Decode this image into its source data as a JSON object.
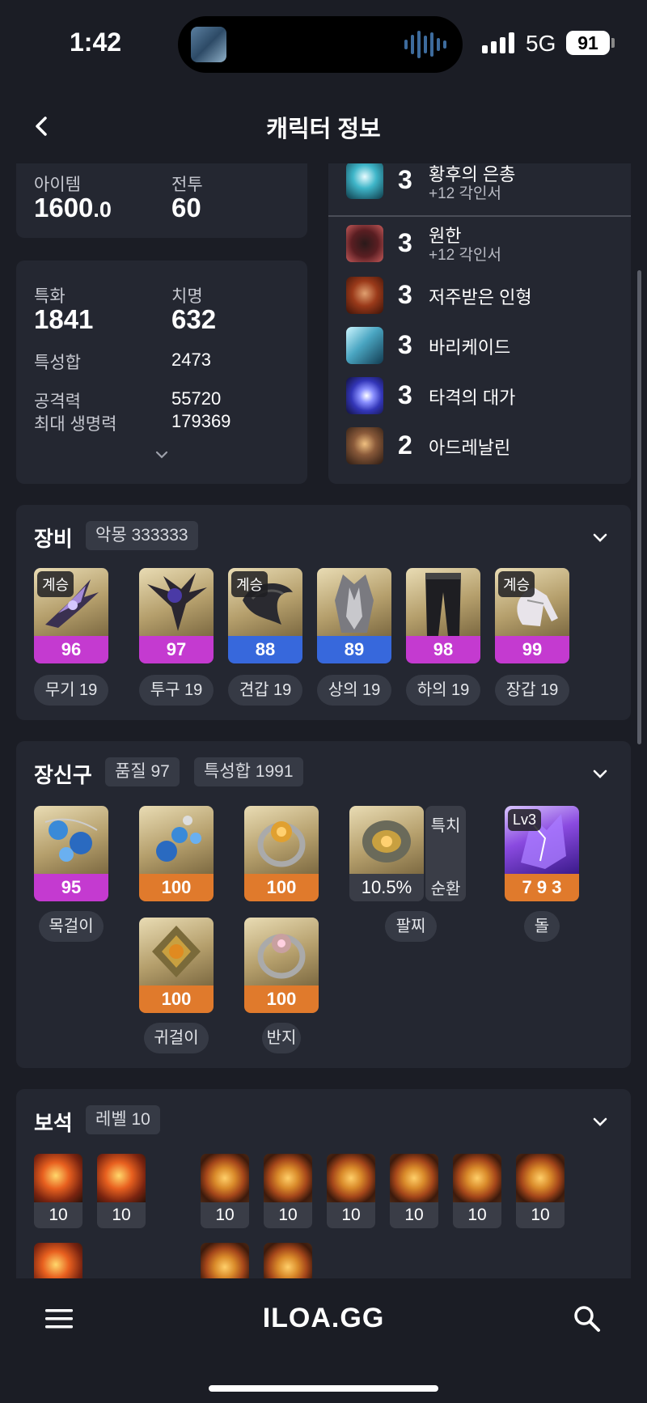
{
  "status": {
    "time": "1:42",
    "network": "5G",
    "battery": "91"
  },
  "header": {
    "title": "캐릭터 정보"
  },
  "stats_top": {
    "item_label": "아이템",
    "item_value": "1600",
    "item_decimal": ".0",
    "combat_label": "전투",
    "combat_value": "60"
  },
  "stats": {
    "spec_label": "특화",
    "spec_value": "1841",
    "crit_label": "치명",
    "crit_value": "632",
    "trait_sum_label": "특성합",
    "trait_sum_value": "2473",
    "attack_label": "공격력",
    "attack_value": "55720",
    "hp_label": "최대 생명력",
    "hp_value": "179369"
  },
  "engravings": [
    {
      "level": "3",
      "name": "황후의 은총",
      "sub": "+12 각인서",
      "icon_color": "#3fb6c9"
    },
    {
      "level": "3",
      "name": "원한",
      "sub": "+12 각인서",
      "icon_color": "#8a2a2a"
    },
    {
      "level": "3",
      "name": "저주받은 인형",
      "sub": "",
      "icon_color": "#b5522a"
    },
    {
      "level": "3",
      "name": "바리케이드",
      "sub": "",
      "icon_color": "#4aa6c2"
    },
    {
      "level": "3",
      "name": "타격의 대가",
      "sub": "",
      "icon_color": "#5b63e0"
    },
    {
      "level": "2",
      "name": "아드레날린",
      "sub": "",
      "icon_color": "#8a5a3a"
    }
  ],
  "equipment": {
    "title": "장비",
    "set_chip": "악몽 333333",
    "items": [
      {
        "quality": "96",
        "slot": "무기 19",
        "inherit": "계승",
        "color": "purple"
      },
      {
        "quality": "97",
        "slot": "투구 19",
        "inherit": "",
        "color": "purple"
      },
      {
        "quality": "88",
        "slot": "견갑 19",
        "inherit": "계승",
        "color": "blue"
      },
      {
        "quality": "89",
        "slot": "상의 19",
        "inherit": "",
        "color": "blue"
      },
      {
        "quality": "98",
        "slot": "하의 19",
        "inherit": "",
        "color": "purple"
      },
      {
        "quality": "99",
        "slot": "장갑 19",
        "inherit": "계승",
        "color": "purple"
      }
    ]
  },
  "accessories": {
    "title": "장신구",
    "quality_chip": "품질 97",
    "trait_chip": "특성합 1991",
    "items": [
      {
        "quality": "95",
        "slot": "목걸이",
        "color": "purple"
      },
      {
        "quality": "100",
        "slot": "",
        "color": "orange"
      },
      {
        "quality": "100",
        "slot": "",
        "color": "orange"
      },
      {
        "quality": "100",
        "slot": "귀걸이",
        "color": "orange"
      },
      {
        "quality": "100",
        "slot": "반지",
        "color": "orange"
      }
    ],
    "bracelet": {
      "value": "10.5%",
      "tag1": "특치",
      "tag2": "순환",
      "slot": "팔찌"
    },
    "stone": {
      "level": "Lv3",
      "value": "7 9 3",
      "slot": "돌"
    }
  },
  "gems": {
    "title": "보석",
    "level_chip": "레벨 10",
    "levels": [
      "10",
      "10",
      "10",
      "10",
      "10",
      "10",
      "10",
      "10"
    ]
  },
  "bottom": {
    "brand": "ILOA.GG"
  }
}
